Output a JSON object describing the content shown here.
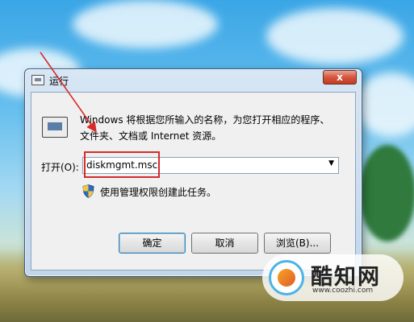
{
  "window": {
    "title": "运行",
    "close_label": "x"
  },
  "dialog": {
    "description": "Windows 将根据您所输入的名称，为您打开相应的程序、文件夹、文档或 Internet 资源。",
    "open_label": "打开(O):",
    "command_value": "diskmgmt.msc",
    "admin_note": "使用管理权限创建此任务。"
  },
  "buttons": {
    "ok": "确定",
    "cancel": "取消",
    "browse": "浏览(B)..."
  },
  "watermark": {
    "name": "酷知网",
    "url": "www.coozhi.com"
  },
  "colors": {
    "highlight": "#d72a2a",
    "arrow": "#d72a2a"
  }
}
